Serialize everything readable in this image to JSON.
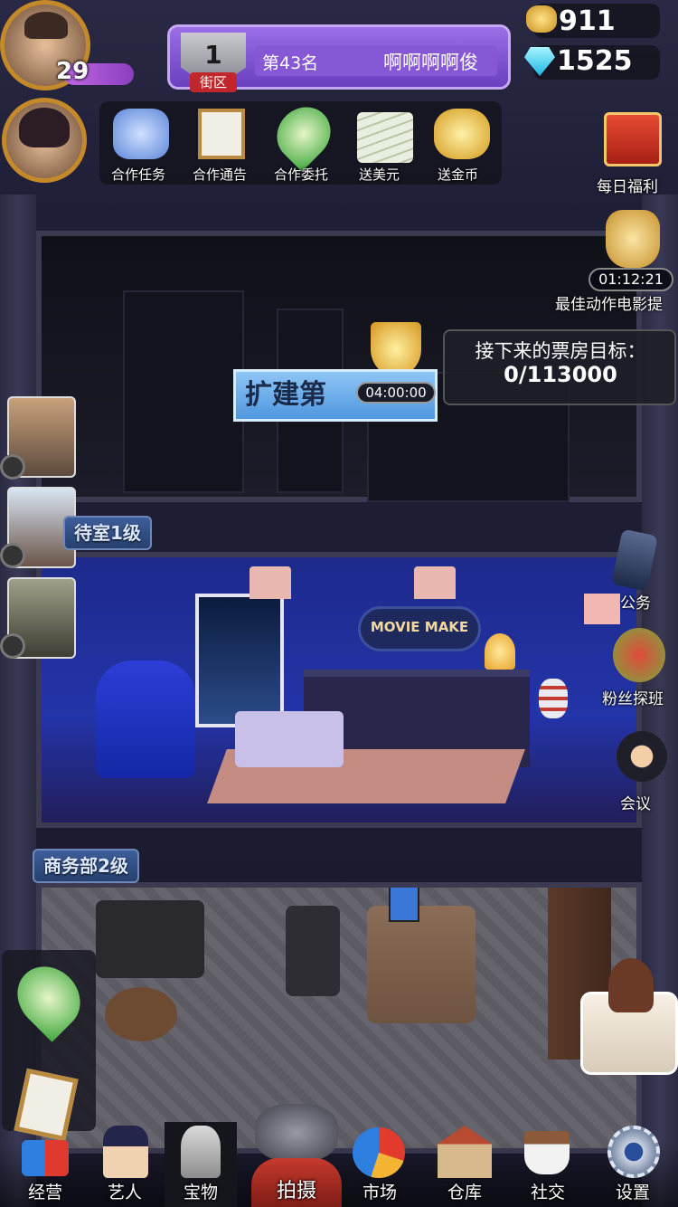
{
  "player": {
    "level": "29"
  },
  "district": {
    "rank_number": "1",
    "district_label": "街区",
    "rank_text": "第43名",
    "player_name": "啊啊啊啊俊"
  },
  "currency": {
    "gold": "911",
    "diamonds": "1525"
  },
  "coop_toolbar": [
    {
      "label": "合作任务",
      "icon": "handshake-icon"
    },
    {
      "label": "合作通告",
      "icon": "notice-clipboard-icon"
    },
    {
      "label": "合作委托",
      "icon": "handshake-badge-icon"
    },
    {
      "label": "送美元",
      "icon": "dollar-stack-icon"
    },
    {
      "label": "送金币",
      "icon": "gold-coin-icon"
    }
  ],
  "right_side": {
    "daily_welfare": "每日福利",
    "timer": "01:12:21",
    "award_event": "最佳动作电影提",
    "phone": "公务",
    "fan_visit": "粉丝探班",
    "meeting": "会议"
  },
  "construction": {
    "expand_label": "扩建第",
    "countdown": "04:00:00",
    "box_office_title": "接下来的票房目标：",
    "box_office_value": "0/113000"
  },
  "rooms": {
    "reception_label": "待室1级",
    "reception_sign": "MOVIE MAKE",
    "business_label": "商务部2级"
  },
  "bottom_nav": [
    {
      "label": "经营",
      "icon": "3d-glasses-icon"
    },
    {
      "label": "艺人",
      "icon": "agent-hat-icon"
    },
    {
      "label": "宝物",
      "icon": "treasure-icon"
    },
    {
      "label": "拍摄",
      "icon": "film-camera-icon"
    },
    {
      "label": "市场",
      "icon": "pie-chart-icon"
    },
    {
      "label": "仓库",
      "icon": "warehouse-icon"
    },
    {
      "label": "社交",
      "icon": "coffee-cup-icon"
    },
    {
      "label": "设置",
      "icon": "gear-icon"
    }
  ],
  "colors": {
    "gold": "#f5c542",
    "diamond": "#38d8f5",
    "district_panel": "#7a4fd0",
    "accent_orange": "#c48a2a"
  }
}
